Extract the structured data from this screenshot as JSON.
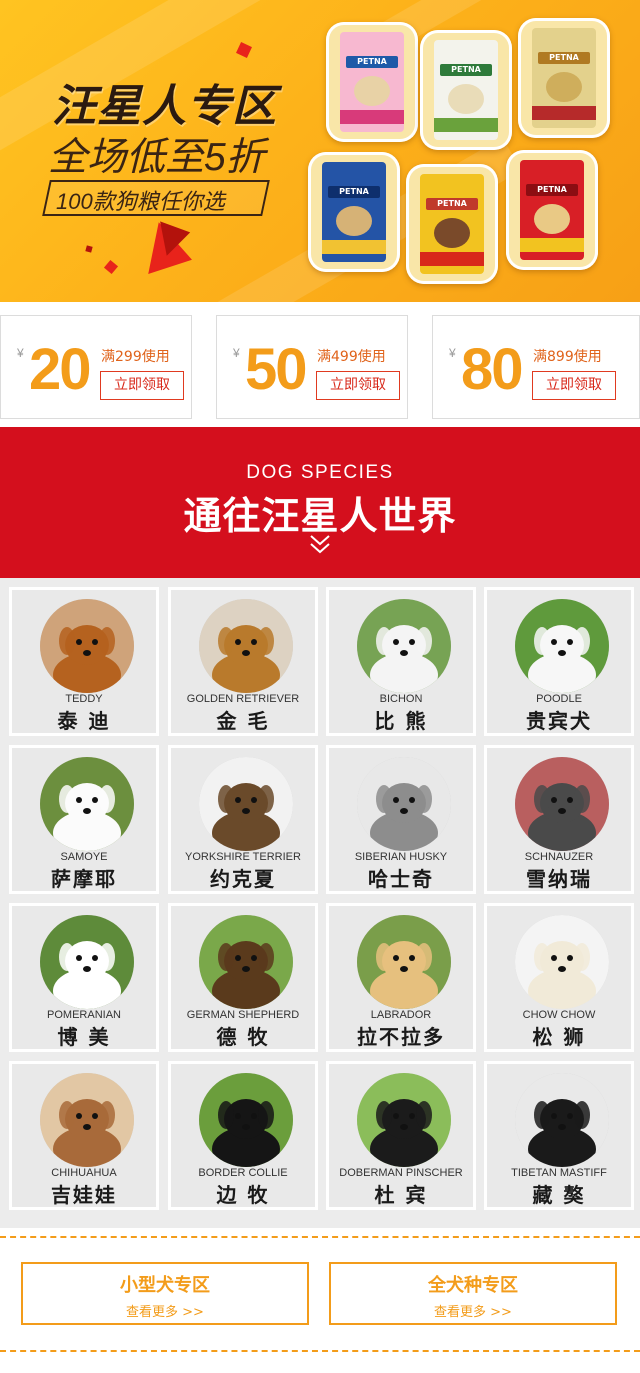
{
  "banner": {
    "title": "汪星人专区",
    "subtitle": "全场低至5折",
    "tag": "100款狗粮任你选",
    "bag_brand": "PETNA"
  },
  "coupons": [
    {
      "yen": "¥",
      "amount": "20",
      "condition": "满299使用",
      "button": "立即领取"
    },
    {
      "yen": "¥",
      "amount": "50",
      "condition": "满499使用",
      "button": "立即领取"
    },
    {
      "yen": "¥",
      "amount": "80",
      "condition": "满899使用",
      "button": "立即领取"
    }
  ],
  "species_section": {
    "eyebrow": "DOG SPECIES",
    "title": "通往汪星人世界"
  },
  "dogs": [
    {
      "en": "TEDDY",
      "cn": "泰 迪",
      "fur": "#b5621f",
      "bg": "#cfa37a"
    },
    {
      "en": "GOLDEN RETRIEVER",
      "cn": "金 毛",
      "fur": "#b97a2c",
      "bg": "#ddd2c2"
    },
    {
      "en": "BICHON",
      "cn": "比 熊",
      "fur": "#f4f4f4",
      "bg": "#77a354"
    },
    {
      "en": "POODLE",
      "cn": "贵宾犬",
      "fur": "#f7f7f7",
      "bg": "#5f9a3c"
    },
    {
      "en": "SAMOYE",
      "cn": "萨摩耶",
      "fur": "#fbfbfb",
      "bg": "#6c8f3e"
    },
    {
      "en": "YORKSHIRE TERRIER",
      "cn": "约克夏",
      "fur": "#6a4a2a",
      "bg": "#f2f2f2"
    },
    {
      "en": "SIBERIAN HUSKY",
      "cn": "哈士奇",
      "fur": "#8d8d8d",
      "bg": "#e8e8e8"
    },
    {
      "en": "SCHNAUZER",
      "cn": "雪纳瑞",
      "fur": "#4a4a4a",
      "bg": "#b95f5f"
    },
    {
      "en": "POMERANIAN",
      "cn": "博 美",
      "fur": "#ffffff",
      "bg": "#5e8b3a"
    },
    {
      "en": "GERMAN SHEPHERD",
      "cn": "德 牧",
      "fur": "#5a3a1c",
      "bg": "#7aa84a"
    },
    {
      "en": "LABRADOR",
      "cn": "拉不拉多",
      "fur": "#e6c07e",
      "bg": "#7a9e4a"
    },
    {
      "en": "CHOW CHOW",
      "cn": "松 狮",
      "fur": "#f1ead8",
      "bg": "#f4f4f4"
    },
    {
      "en": "CHIHUAHUA",
      "cn": "吉娃娃",
      "fur": "#a86a3a",
      "bg": "#e2c7a4"
    },
    {
      "en": "BORDER COLLIE",
      "cn": "边 牧",
      "fur": "#151515",
      "bg": "#6b9e3c"
    },
    {
      "en": "DOBERMAN PINSCHER",
      "cn": "杜 宾",
      "fur": "#1b1b1b",
      "bg": "#8bbd5a"
    },
    {
      "en": "TIBETAN MASTIFF",
      "cn": "藏 獒",
      "fur": "#1a1a1a",
      "bg": "#e9e9e9"
    }
  ],
  "zones": [
    {
      "title": "小型犬专区",
      "more": "查看更多 >>"
    },
    {
      "title": "全犬种专区",
      "more": "查看更多 >>"
    }
  ],
  "colors": {
    "accent_orange": "#f39c1a",
    "section_red": "#d40f1d",
    "banner_yellow": "#fdb21a"
  }
}
